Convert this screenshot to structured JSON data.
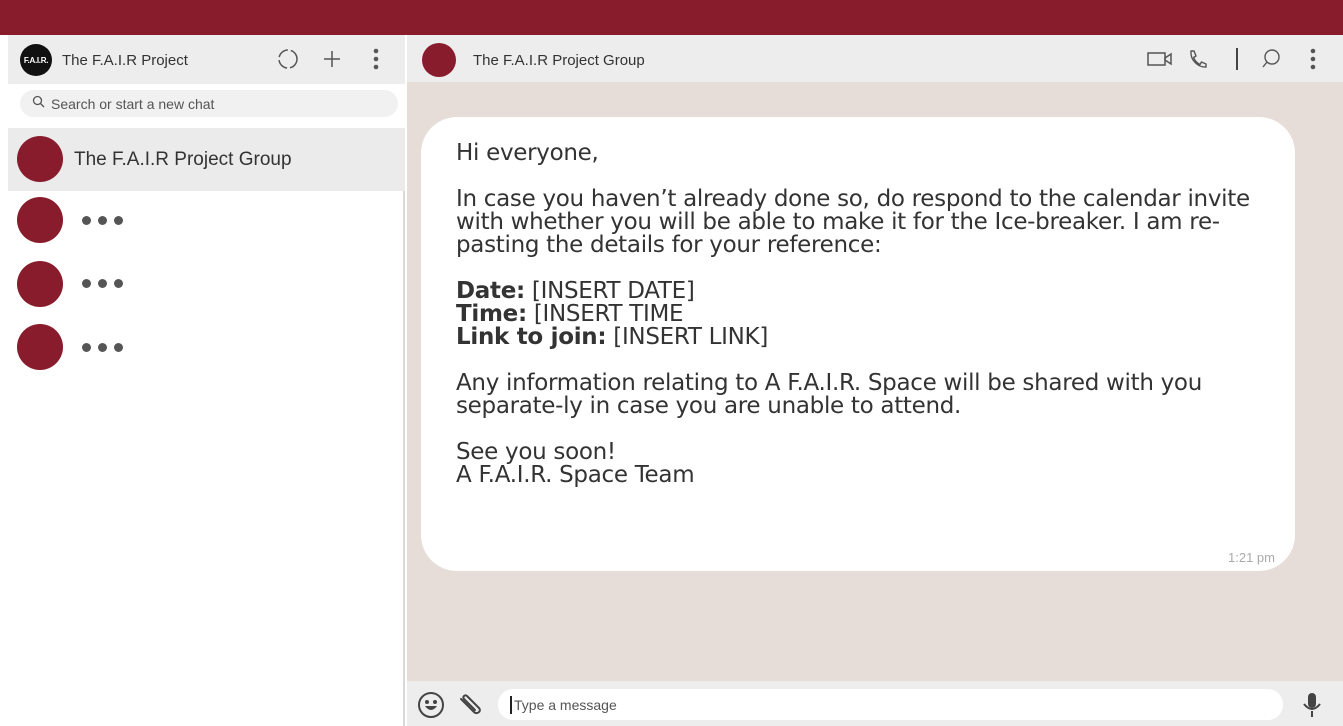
{
  "colors": {
    "brand": "#891c2c",
    "header_bg": "#ededed",
    "chat_bg": "#e6ddd8"
  },
  "sidebar": {
    "logo_text": "F.A.I.R.",
    "title": "The F.A.I.R Project",
    "icons": [
      "status-icon",
      "new-chat-icon",
      "menu-icon"
    ],
    "search": {
      "placeholder": "Search or start a new chat"
    },
    "chats": [
      {
        "name": "The F.A.I.R Project Group",
        "active": true
      },
      {
        "name": "",
        "placeholder": true
      },
      {
        "name": "",
        "placeholder": true
      },
      {
        "name": "",
        "placeholder": true
      }
    ]
  },
  "conversation": {
    "title": "The F.A.I.R Project Group",
    "icons": [
      "video-call-icon",
      "voice-call-icon",
      "search-icon",
      "menu-icon"
    ],
    "message": {
      "greeting": "Hi everyone,",
      "body1": "In case you haven’t already done so, do respond to the calendar invite with whether you will be able to make it for the Ice-breaker. I am re-pasting the details for your reference:",
      "date_label": "Date:",
      "date_value": " [INSERT DATE]",
      "time_label": "Time:",
      "time_value": " [INSERT TIME",
      "link_label": "Link to join:",
      "link_value": " [INSERT LINK]",
      "body2": "Any information relating to A F.A.I.R. Space will be shared with you separate-ly in case you are unable to attend.",
      "closing": "See you soon!",
      "signature": "A F.A.I.R. Space Team",
      "timestamp": "1:21 pm"
    },
    "composer": {
      "placeholder": "Type a message",
      "icons": [
        "emoji-icon",
        "attach-icon",
        "microphone-icon"
      ]
    }
  }
}
